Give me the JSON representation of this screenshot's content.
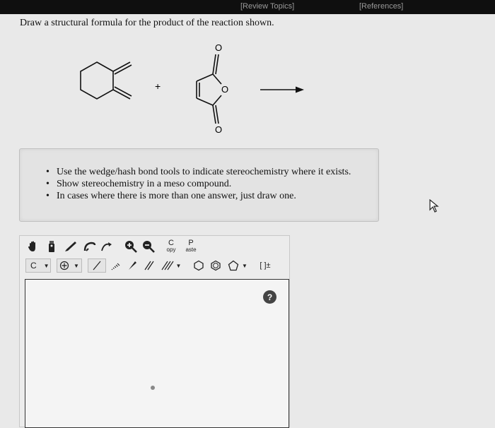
{
  "topbar": {
    "review_topics": "[Review Topics]",
    "references": "[References]"
  },
  "question": "Draw a structural formula for the product of the reaction shown.",
  "reaction": {
    "plus": "+",
    "oxygen_top": "O",
    "oxygen_ring": "O",
    "oxygen_bottom": "O"
  },
  "instructions": [
    "Use the wedge/hash bond tools to indicate stereochemistry where it exists.",
    "Show stereochemistry in a meso compound.",
    "In cases where there is more than one answer, just draw one."
  ],
  "toolbar": {
    "copy_letter": "C",
    "copy_label": "opy",
    "paste_letter": "P",
    "paste_label": "aste",
    "element_select": "C",
    "bracket_tool": "[ ]±",
    "help": "?"
  }
}
